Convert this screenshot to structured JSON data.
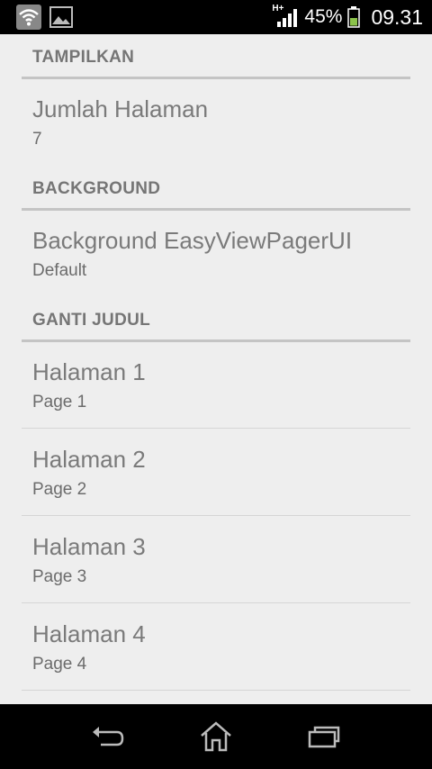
{
  "status_bar": {
    "network_label": "H+",
    "battery_percent": "45%",
    "time": "09.31",
    "icons": [
      "wifi-icon",
      "image-icon",
      "signal-icon",
      "battery-icon"
    ]
  },
  "sections": [
    {
      "header": "TAMPILKAN",
      "items": [
        {
          "title": "Jumlah Halaman",
          "summary": "7"
        }
      ]
    },
    {
      "header": "BACKGROUND",
      "items": [
        {
          "title": "Background EasyViewPagerUI",
          "summary": "Default"
        }
      ]
    },
    {
      "header": "GANTI JUDUL",
      "items": [
        {
          "title": "Halaman 1",
          "summary": "Page 1"
        },
        {
          "title": "Halaman 2",
          "summary": "Page 2"
        },
        {
          "title": "Halaman 3",
          "summary": "Page 3"
        },
        {
          "title": "Halaman 4",
          "summary": "Page 4"
        }
      ]
    }
  ],
  "nav_bar": {
    "icons": [
      "back-icon",
      "home-icon",
      "recent-apps-icon"
    ]
  },
  "colors": {
    "background": "#eeeeee",
    "header_text": "#757575",
    "title_text": "#7a7a7a",
    "summary_text": "#6c6c6c",
    "header_rule": "#c4c4c4"
  }
}
